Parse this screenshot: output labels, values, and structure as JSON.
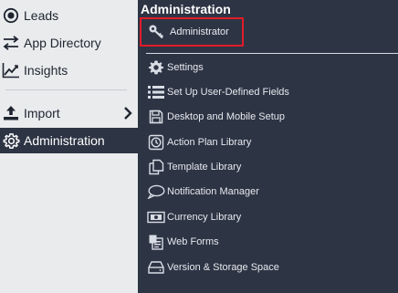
{
  "sidebar": {
    "items": [
      {
        "label": "Leads",
        "icon": "target-icon"
      },
      {
        "label": "App Directory",
        "icon": "arrows-icon"
      },
      {
        "label": "Insights",
        "icon": "chart-icon"
      },
      {
        "label": "Import",
        "icon": "upload-icon"
      },
      {
        "label": "Administration",
        "icon": "gear-icon"
      }
    ]
  },
  "panel": {
    "title": "Administration",
    "administrator_label": "Administrator",
    "items": [
      {
        "label": "Settings",
        "icon": "gear-icon"
      },
      {
        "label": "Set Up User-Defined Fields",
        "icon": "list-icon"
      },
      {
        "label": "Desktop and Mobile Setup",
        "icon": "save-icon"
      },
      {
        "label": "Action Plan Library",
        "icon": "clock-icon"
      },
      {
        "label": "Template Library",
        "icon": "copy-icon"
      },
      {
        "label": "Notification Manager",
        "icon": "speech-bubble-icon"
      },
      {
        "label": "Currency Library",
        "icon": "money-icon"
      },
      {
        "label": "Web Forms",
        "icon": "forms-icon"
      },
      {
        "label": "Version & Storage Space",
        "icon": "storage-icon"
      }
    ]
  },
  "colors": {
    "sidebar_bg": "#e9ebed",
    "panel_bg": "#2d3444",
    "highlight_border": "#e21b2a",
    "text_light": "#e6e9ee",
    "text_dark": "#1f2530"
  }
}
